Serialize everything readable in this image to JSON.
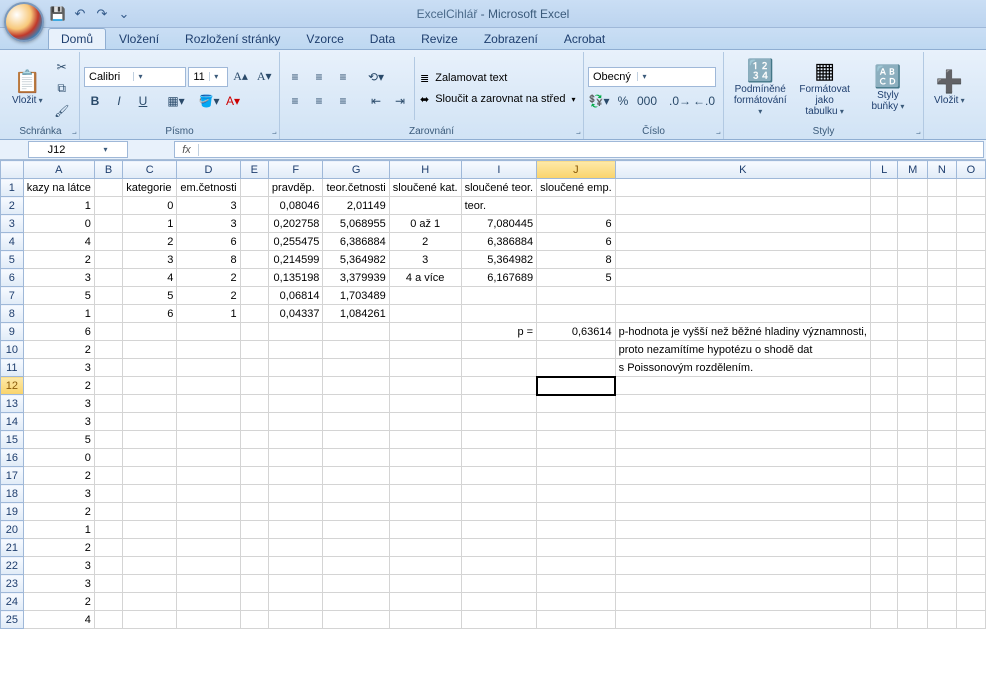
{
  "titlebar": {
    "qat_tip": "⌄",
    "title_doc": "ExcelCihlář",
    "title_app": "Microsoft Excel"
  },
  "tabs": {
    "items": [
      "Domů",
      "Vložení",
      "Rozložení stránky",
      "Vzorce",
      "Data",
      "Revize",
      "Zobrazení",
      "Acrobat"
    ],
    "active": 0
  },
  "ribbon": {
    "clipboard": {
      "label": "Schránka",
      "paste": "Vložit"
    },
    "font": {
      "label": "Písmo",
      "name": "Calibri",
      "size": "11",
      "bold": "B",
      "italic": "I",
      "underline": "U"
    },
    "align": {
      "label": "Zarovnání",
      "wrap": "Zalamovat text",
      "merge": "Sloučit a zarovnat na střed"
    },
    "number": {
      "label": "Číslo",
      "format": "Obecný"
    },
    "styles": {
      "label": "Styly",
      "cond": "Podmíněné formátování",
      "table": "Formátovat jako tabulku",
      "cellstyles": "Styly buňky"
    },
    "cells": {
      "insert": "Vložit"
    }
  },
  "fxrow": {
    "name": "J12",
    "formula": ""
  },
  "sheet": {
    "columns": [
      "A",
      "B",
      "C",
      "D",
      "E",
      "F",
      "G",
      "H",
      "I",
      "J",
      "K",
      "L",
      "M",
      "N",
      "O"
    ],
    "col_widths": {
      "A": 56,
      "B": 56,
      "C": 56,
      "D": 56,
      "E": 56,
      "F": 56,
      "G": 56,
      "H": 56,
      "I": 56,
      "J": 56,
      "K": 56,
      "default": 56
    },
    "selected_cell": {
      "col": "J",
      "row": 12
    },
    "rows": 25,
    "cells": {
      "A1": {
        "v": "kazy na látce",
        "a": "left"
      },
      "C1": {
        "v": "kategorie",
        "a": "left"
      },
      "D1": {
        "v": "em.četnosti",
        "a": "left"
      },
      "F1": {
        "v": "pravděp.",
        "a": "left"
      },
      "G1": {
        "v": "teor.četnosti",
        "a": "left"
      },
      "H1": {
        "v": "sloučené kat.",
        "a": "left"
      },
      "I1": {
        "v": "sloučené teor.",
        "a": "left"
      },
      "J1": {
        "v": "sloučené emp.",
        "a": "left"
      },
      "A2": {
        "v": "1"
      },
      "C2": {
        "v": "0"
      },
      "D2": {
        "v": "3"
      },
      "F2": {
        "v": "0,08046"
      },
      "G2": {
        "v": "2,01149"
      },
      "I2": {
        "v": "teor.",
        "a": "left"
      },
      "A3": {
        "v": "0"
      },
      "C3": {
        "v": "1"
      },
      "D3": {
        "v": "3"
      },
      "F3": {
        "v": "0,202758"
      },
      "G3": {
        "v": "5,068955"
      },
      "H3": {
        "v": "0 až 1",
        "a": "center"
      },
      "I3": {
        "v": "7,080445"
      },
      "J3": {
        "v": "6"
      },
      "A4": {
        "v": "4"
      },
      "C4": {
        "v": "2"
      },
      "D4": {
        "v": "6"
      },
      "F4": {
        "v": "0,255475"
      },
      "G4": {
        "v": "6,386884"
      },
      "H4": {
        "v": "2",
        "a": "center"
      },
      "I4": {
        "v": "6,386884"
      },
      "J4": {
        "v": "6"
      },
      "A5": {
        "v": "2"
      },
      "C5": {
        "v": "3"
      },
      "D5": {
        "v": "8"
      },
      "F5": {
        "v": "0,214599"
      },
      "G5": {
        "v": "5,364982"
      },
      "H5": {
        "v": "3",
        "a": "center"
      },
      "I5": {
        "v": "5,364982"
      },
      "J5": {
        "v": "8"
      },
      "A6": {
        "v": "3"
      },
      "C6": {
        "v": "4"
      },
      "D6": {
        "v": "2"
      },
      "F6": {
        "v": "0,135198"
      },
      "G6": {
        "v": "3,379939"
      },
      "H6": {
        "v": "4 a více",
        "a": "center"
      },
      "I6": {
        "v": "6,167689"
      },
      "J6": {
        "v": "5"
      },
      "A7": {
        "v": "5"
      },
      "C7": {
        "v": "5"
      },
      "D7": {
        "v": "2"
      },
      "F7": {
        "v": "0,06814"
      },
      "G7": {
        "v": "1,703489"
      },
      "A8": {
        "v": "1"
      },
      "C8": {
        "v": "6"
      },
      "D8": {
        "v": "1"
      },
      "F8": {
        "v": "0,04337"
      },
      "G8": {
        "v": "1,084261"
      },
      "A9": {
        "v": "6"
      },
      "I9": {
        "v": "p =",
        "a": "right"
      },
      "J9": {
        "v": "0,63614"
      },
      "K9": {
        "v": "p-hodnota je vyšší než běžné hladiny významnosti,",
        "a": "left",
        "overflow": true
      },
      "A10": {
        "v": "2"
      },
      "K10": {
        "v": "proto nezamítíme hypotézu o shodě dat",
        "a": "left",
        "overflow": true
      },
      "A11": {
        "v": "3"
      },
      "K11": {
        "v": "s Poissonovým rozdělením.",
        "a": "left",
        "overflow": true
      },
      "A12": {
        "v": "2"
      },
      "A13": {
        "v": "3"
      },
      "A14": {
        "v": "3"
      },
      "A15": {
        "v": "5"
      },
      "A16": {
        "v": "0"
      },
      "A17": {
        "v": "2"
      },
      "A18": {
        "v": "3"
      },
      "A19": {
        "v": "2"
      },
      "A20": {
        "v": "1"
      },
      "A21": {
        "v": "2"
      },
      "A22": {
        "v": "3"
      },
      "A23": {
        "v": "3"
      },
      "A24": {
        "v": "2"
      },
      "A25": {
        "v": "4"
      }
    }
  }
}
